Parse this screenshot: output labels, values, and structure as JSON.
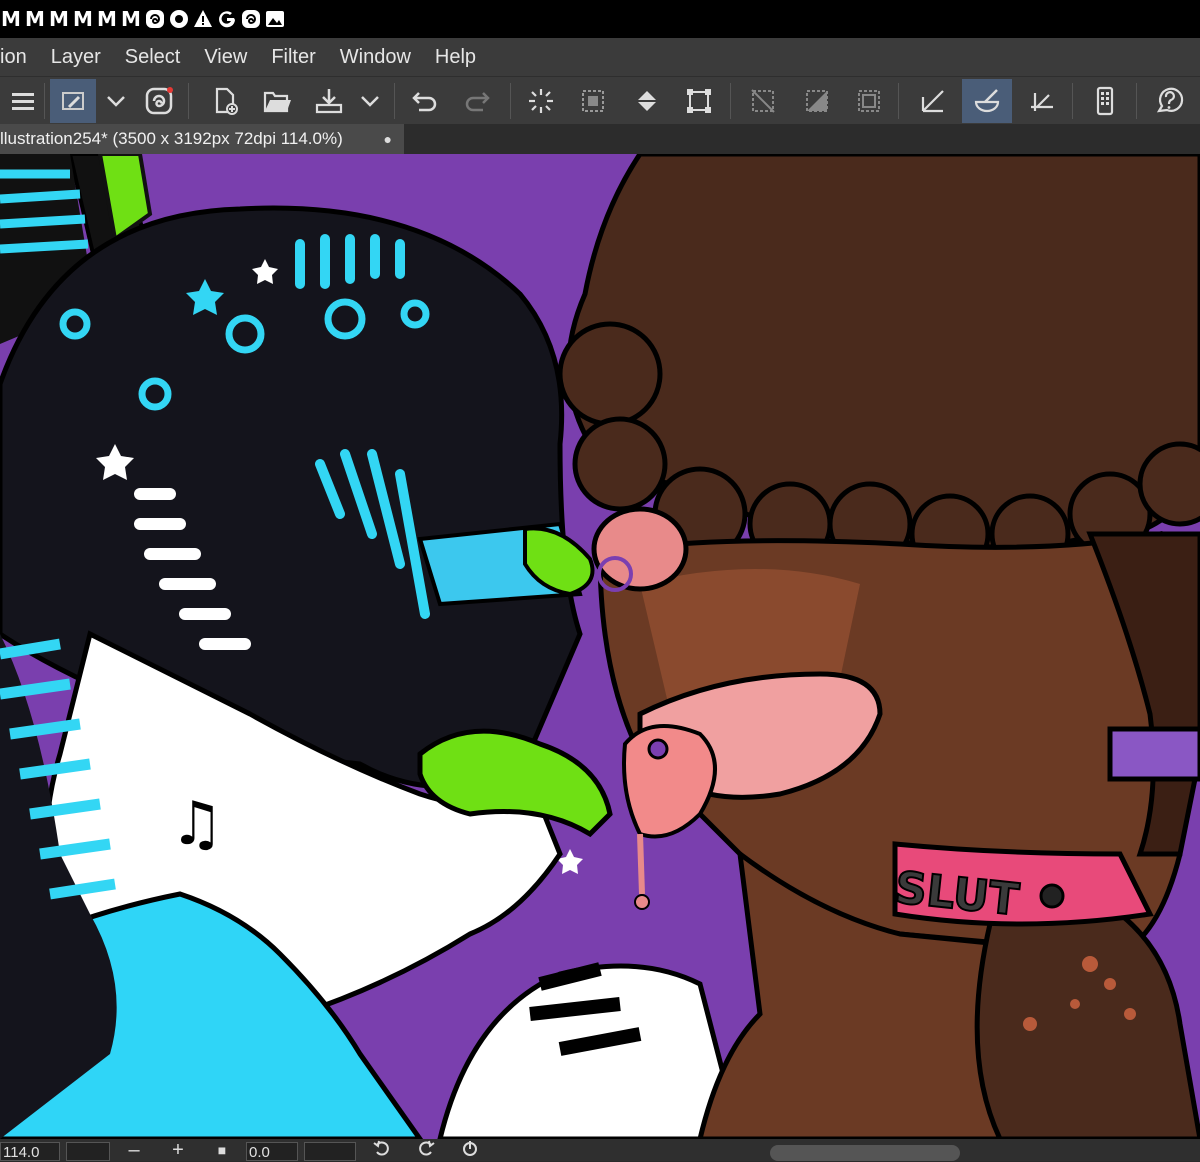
{
  "status_bar": {
    "icons": [
      "M",
      "M",
      "M",
      "M",
      "M",
      "M",
      "spiral-icon",
      "circle-logo-icon",
      "warning-icon",
      "google-icon",
      "spiral-icon",
      "image-icon"
    ]
  },
  "menu": {
    "items": [
      "ion",
      "Layer",
      "Select",
      "View",
      "Filter",
      "Window",
      "Help"
    ]
  },
  "document": {
    "tab_title": "llustration254* (3500 x 3192px 72dpi 114.0%)",
    "tab_dot": "●"
  },
  "artwork": {
    "collar_text": "SLUT"
  },
  "bottom": {
    "zoom_value": "114.0",
    "zoom_out": "–",
    "zoom_in": "+",
    "rotation_value": "0.0"
  },
  "colors": {
    "canvas_background": "#7a3fae",
    "toolbar_active": "#4a5d78",
    "menubar": "#3b3b3b"
  }
}
